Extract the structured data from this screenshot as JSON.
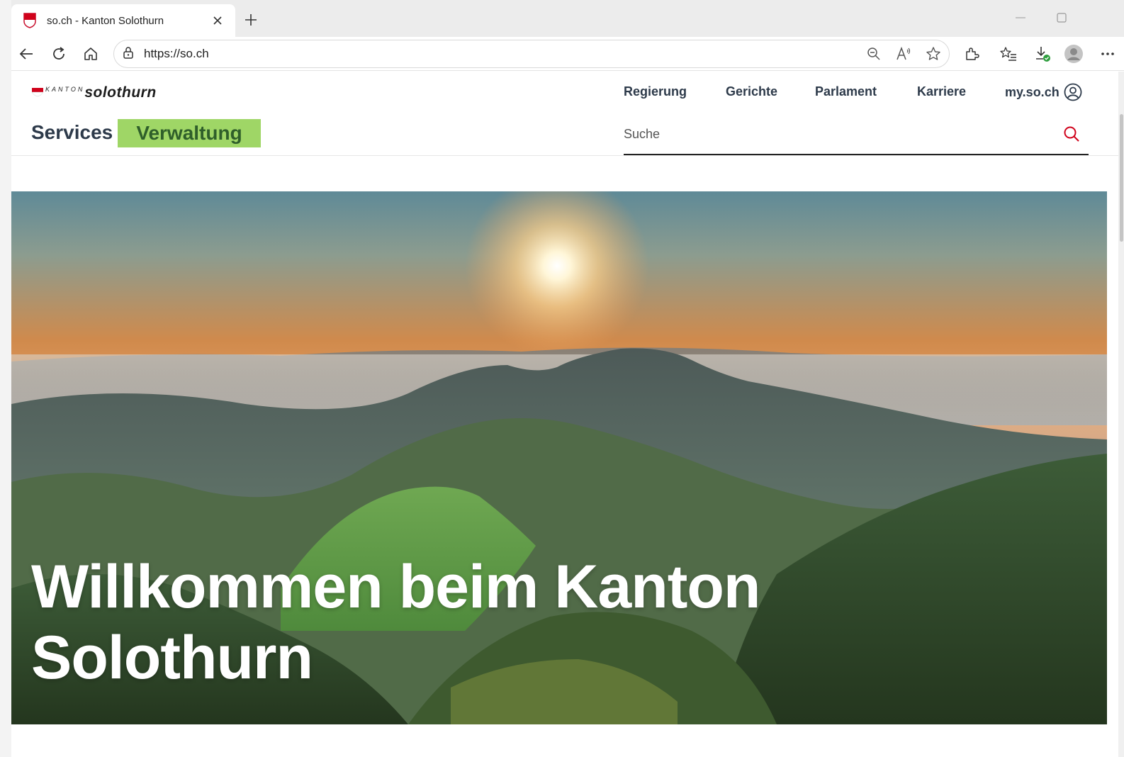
{
  "browser": {
    "tab_title": "so.ch - Kanton Solothurn",
    "url": "https://so.ch",
    "icons": [
      "tab-favicon-icon",
      "close-icon",
      "plus-icon",
      "minimize-icon",
      "maximize-icon",
      "back-icon",
      "reload-icon",
      "home-icon",
      "lock-icon",
      "zoom-out-icon",
      "read-aloud-icon",
      "favorite-star-icon",
      "extensions-icon",
      "favorites-list-icon",
      "downloads-icon",
      "profile-avatar-icon",
      "more-icon"
    ]
  },
  "site": {
    "logo": {
      "prefix": "KANTON",
      "name": "solothurn"
    },
    "nav": {
      "regierung": "Regierung",
      "gerichte": "Gerichte",
      "parlament": "Parlament",
      "karriere": "Karriere",
      "myso": "my.so.ch"
    },
    "audience": {
      "services": "Services",
      "verwaltung": "Verwaltung"
    },
    "search": {
      "placeholder": "Suche"
    },
    "hero": {
      "line1": "Willkommen beim Kanton",
      "line2": "Solothurn"
    },
    "colors": {
      "accent_red": "#d0021b",
      "highlight_green": "#9fd666",
      "nav_text": "#2d3a4a"
    }
  }
}
